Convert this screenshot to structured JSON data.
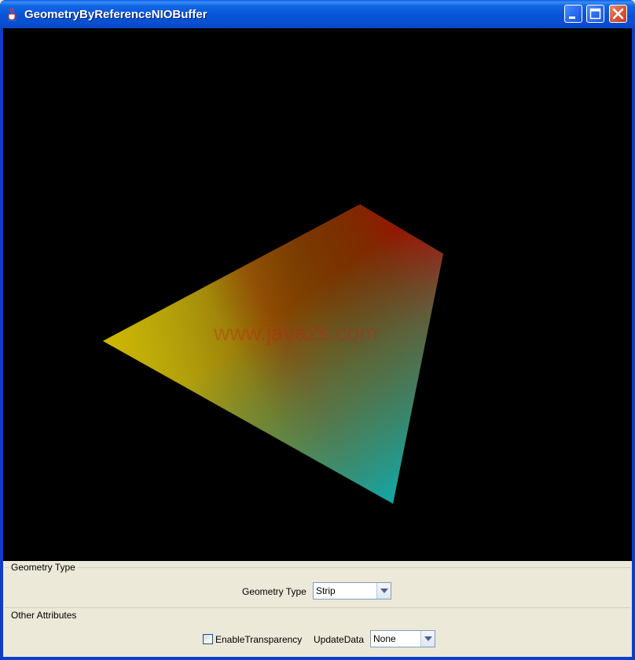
{
  "window": {
    "title": "GeometryByReferenceNIOBuffer",
    "app_icon": "java-cup-icon",
    "buttons": [
      "minimize-icon",
      "maximize-icon",
      "close-icon"
    ]
  },
  "canvas": {
    "background": "#000000",
    "watermark": "www.java2s.com",
    "shape_colors": [
      "#e0c400",
      "#00a000",
      "#c00000",
      "#10b0b0"
    ]
  },
  "geometry_group": {
    "title": "Geometry Type",
    "label": "Geometry Type",
    "selected": "Strip"
  },
  "other_group": {
    "title": "Other Attributes",
    "transparency_label": "EnableTransparency",
    "transparency_checked": false,
    "update_label": "UpdateData",
    "update_selected": "None"
  }
}
